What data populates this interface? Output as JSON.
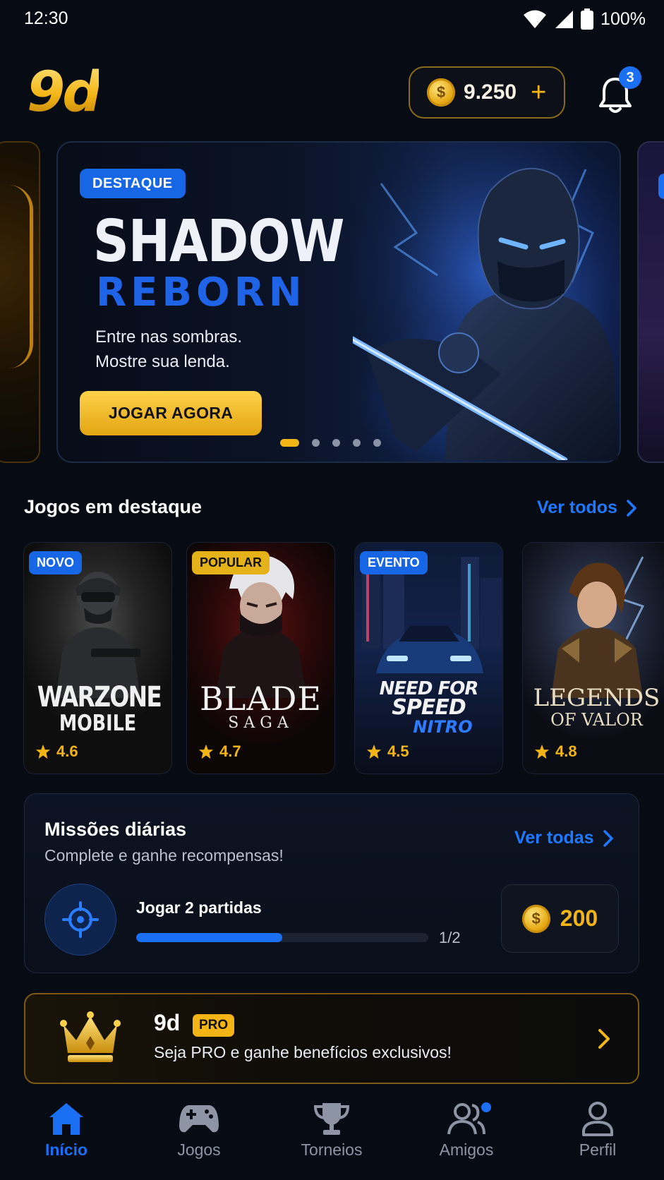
{
  "status_bar": {
    "time": "12:30",
    "battery": "100%"
  },
  "header": {
    "logo": "9d",
    "coins": "9.250",
    "plus": "+",
    "notifications": "3"
  },
  "hero": {
    "badge": "DESTAQUE",
    "title_line1": "SHADOW",
    "title_line2": "REBORN",
    "tagline_line1": "Entre nas sombras.",
    "tagline_line2": "Mostre sua lenda.",
    "cta": "JOGAR AGORA",
    "slides": 5,
    "active_slide": 1
  },
  "featured": {
    "title": "Jogos em destaque",
    "see_all": "Ver todos",
    "games": [
      {
        "tag": "NOVO",
        "logo_line1": "WARZONE",
        "logo_line2": "MOBILE",
        "rating": "4.6"
      },
      {
        "tag": "POPULAR",
        "logo_line1": "BLADE",
        "logo_line2": "SAGA",
        "rating": "4.7"
      },
      {
        "tag": "EVENTO",
        "logo_line1": "NEED FOR",
        "logo_line2": "SPEED",
        "logo_line3": "NITRO",
        "rating": "4.5"
      },
      {
        "tag": "",
        "logo_line1": "LEGENDS",
        "logo_line2": "OF VALOR",
        "rating": "4.8"
      }
    ]
  },
  "missions": {
    "title": "Missões diárias",
    "subtitle": "Complete e ganhe recompensas!",
    "see_all": "Ver todas",
    "task": "Jogar 2 partidas",
    "progress_count": "1/2",
    "progress_fraction": 0.5,
    "reward": "200"
  },
  "pro": {
    "name": "9d",
    "badge": "PRO",
    "text": "Seja PRO e ganhe benefícios exclusivos!"
  },
  "nav": {
    "items": [
      {
        "label": "Início",
        "icon": "home-icon",
        "active": true
      },
      {
        "label": "Jogos",
        "icon": "gamepad-icon",
        "active": false
      },
      {
        "label": "Torneios",
        "icon": "trophy-icon",
        "active": false
      },
      {
        "label": "Amigos",
        "icon": "friends-icon",
        "active": false
      },
      {
        "label": "Perfil",
        "icon": "profile-icon",
        "active": false
      }
    ]
  },
  "colors": {
    "accent": "#1a6ff2",
    "gold": "#f2b515",
    "background": "#070b14"
  }
}
